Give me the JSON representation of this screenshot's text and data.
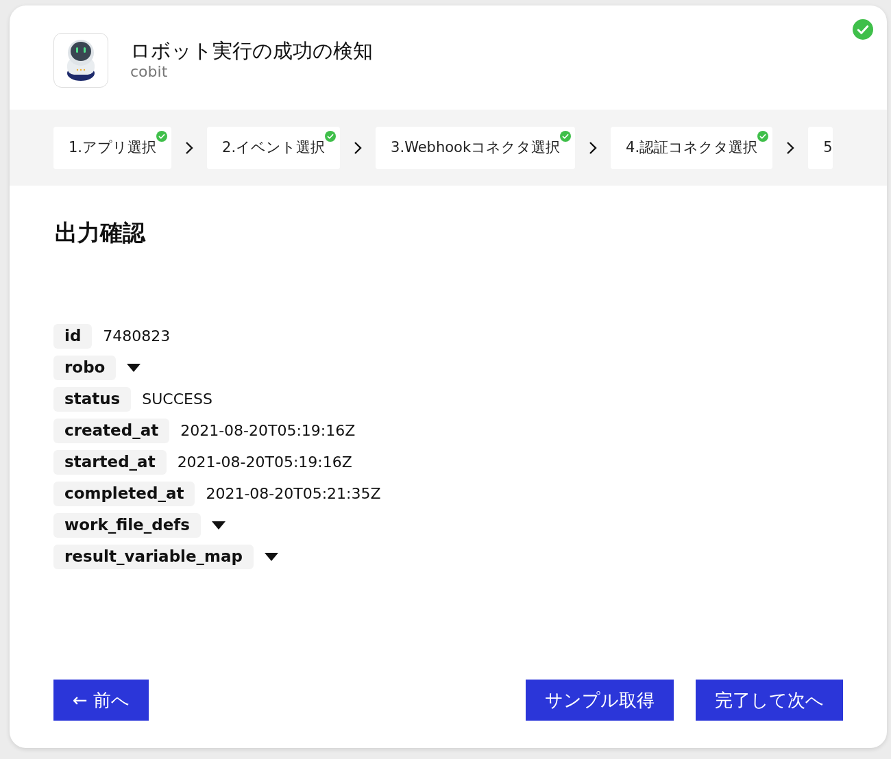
{
  "header": {
    "title": "ロボット実行の成功の検知",
    "subtitle": "cobit",
    "completed": true
  },
  "steps": [
    {
      "label": "1.アプリ選択",
      "completed": true
    },
    {
      "label": "2.イベント選択",
      "completed": true
    },
    {
      "label": "3.Webhookコネクタ選択",
      "completed": true
    },
    {
      "label": "4.認証コネクタ選択",
      "completed": true
    },
    {
      "label": "5",
      "completed": false
    }
  ],
  "section_title": "出力確認",
  "fields": [
    {
      "key": "id",
      "kind": "value",
      "value": "7480823"
    },
    {
      "key": "robo",
      "kind": "collapsible",
      "expanded": false
    },
    {
      "key": "status",
      "kind": "value",
      "value": "SUCCESS"
    },
    {
      "key": "created_at",
      "kind": "value",
      "value": "2021-08-20T05:19:16Z"
    },
    {
      "key": "started_at",
      "kind": "value",
      "value": "2021-08-20T05:19:16Z"
    },
    {
      "key": "completed_at",
      "kind": "value",
      "value": "2021-08-20T05:21:35Z"
    },
    {
      "key": "work_file_defs",
      "kind": "collapsible",
      "expanded": false
    },
    {
      "key": "result_variable_map",
      "kind": "collapsible",
      "expanded": false
    }
  ],
  "buttons": {
    "back": "← 前へ",
    "sample": "サンプル取得",
    "next": "完了して次へ"
  }
}
